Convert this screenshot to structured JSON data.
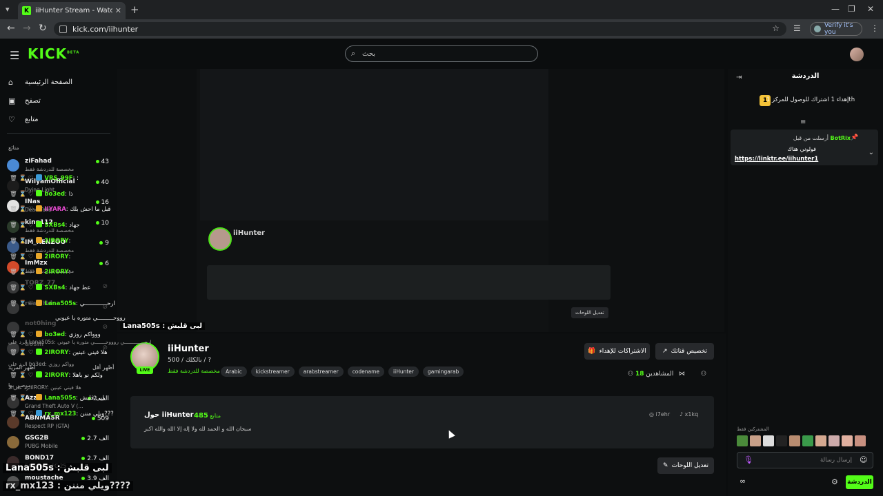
{
  "browser": {
    "tab_title": "iiHunter Stream - Watch Live o",
    "url": "kick.com/iihunter",
    "verify_label": "Verify it's you"
  },
  "topbar": {
    "search_placeholder": "بحث"
  },
  "sidebar": {
    "nav": [
      {
        "label": "الصفحة الرئيسية",
        "icon": "home-icon"
      },
      {
        "label": "تصفح",
        "icon": "browse-icon"
      },
      {
        "label": "متابع",
        "icon": "heart-icon"
      }
    ],
    "following_header": "متابَع",
    "following": [
      {
        "name": "ziFahad",
        "sub": "مخصصة للدردشة فقط",
        "viewers": "43",
        "live": true,
        "color": "#4a8ad6"
      },
      {
        "name": "WilyamOfficial",
        "sub": "Dying Light",
        "viewers": "40",
        "live": true,
        "color": "#1c1c1c"
      },
      {
        "name": "INas",
        "sub": "Dead Take",
        "viewers": "16",
        "live": true,
        "color": "#e2e2e2"
      },
      {
        "name": "king112",
        "sub": "مخصصة للدردشة فقط",
        "viewers": "10",
        "live": true,
        "color": "#2a3a2a"
      },
      {
        "name": "IM_RENZOO",
        "sub": "مخصصة للدردشة فقط",
        "viewers": "9",
        "live": true,
        "color": "#3a5a8a"
      },
      {
        "name": "ImMzx",
        "sub": "مخصصة للدردشة فقط",
        "viewers": "6",
        "live": true,
        "color": "#d24a2a"
      },
      {
        "name": "TORZ_77",
        "sub": "",
        "viewers": "",
        "live": false,
        "color": "#888"
      },
      {
        "name": "realFHd",
        "sub": "",
        "viewers": "",
        "live": false,
        "color": "#888"
      },
      {
        "name": "not0hing",
        "sub": "",
        "viewers": "",
        "live": false,
        "color": "#888"
      },
      {
        "name": "a8sm",
        "sub": "",
        "viewers": "",
        "live": false,
        "color": "#888"
      }
    ],
    "show_more": "أظهر المزيد",
    "show_less": "أظهر أقل",
    "recommended_header": "موصى بها",
    "recommended": [
      {
        "name": "Azzz",
        "sub": "Grand Theft Auto V (...",
        "viewers": "2 الف",
        "color": "#333"
      },
      {
        "name": "ABNMASR",
        "sub": "Respect RP (GTA)",
        "viewers": "509",
        "color": "#5a3a2a"
      },
      {
        "name": "GSG2B",
        "sub": "PUBG Mobile",
        "viewers": "2.7 الف",
        "color": "#8a6a3a"
      },
      {
        "name": "BOND17",
        "sub": "EA Sports FC 25",
        "viewers": "2.7 الف",
        "color": "#3a2a2a"
      },
      {
        "name": "moustache",
        "sub": "",
        "viewers": "3.9 الف",
        "color": "#555"
      }
    ]
  },
  "channel": {
    "name": "iiHunter",
    "subtitle": "بالكلك / 500 / ?",
    "category": "مخصصة للدردشة فقط",
    "live_badge": "LIVE",
    "tags": [
      "Arabic",
      "kickstreamer",
      "arabstreamer",
      "codename",
      "iiHunter",
      "gamingarab"
    ],
    "subs_button": "الاشتراكات للإهداء",
    "customize_button": "تخصيص قناتك",
    "viewers_label": "المشاهدين",
    "viewers_count": "18",
    "about_title": "حول iiHunter",
    "followers_count": "485",
    "followers_label": "متابع",
    "about_text": "سبحان الله و الحمد لله ولا إله إلا الله والله اكبر",
    "social_1": "i7ehr",
    "social_2": "x1kq",
    "edit_panels_button": "تعديل اللوحات"
  },
  "chat": {
    "title": "الدردشة",
    "goal_text": "إهداء 1 اشتراك للوصول للمركز 1th",
    "pinned_sent_by": "أرسلت من قبل",
    "pinned_user": "BotRix",
    "pinned_text": "فولوني هناك",
    "pinned_link": "https://linktr.ee/iihunter1",
    "messages": [
      {
        "user": "VRS_99F",
        "text": ":",
        "color": "#53fc18",
        "badge": "#3a9ad6"
      },
      {
        "user": "bo3ed",
        "text": "ذا",
        "color": "#53fc18",
        "badge": "#53fc18"
      },
      {
        "user": "IIYARA",
        "text": "قبل ما احش بلك",
        "color": "#e64ad0",
        "badge": "#e8a72a"
      },
      {
        "user": "SXBs4",
        "text": "جهاد",
        "color": "#53fc18",
        "badge": "#53fc18"
      },
      {
        "user": "2IRORY",
        "text": "",
        "color": "#53fc18",
        "badge": "#e8a72a"
      },
      {
        "user": "2IRORY",
        "text": "",
        "color": "#53fc18",
        "badge": "#e8a72a"
      },
      {
        "user": "2IRORY",
        "text": "",
        "color": "#53fc18",
        "badge": "#e8a72a"
      },
      {
        "user": "SXBs4",
        "text": "عط جهاد",
        "color": "#53fc18",
        "badge": "#53fc18"
      },
      {
        "user": "Lana505s",
        "text": "ارحـــــــــــــي",
        "color": "#53fc18",
        "badge": "#e8a72a"
      },
      {
        "user": "",
        "text": "رووحـــــــــي متوره يا عيوني",
        "color": "#eee",
        "badge": ""
      },
      {
        "user": "bo3ed",
        "text": "ووواكم روزي",
        "color": "#53fc18",
        "badge": "#e8a72a"
      }
    ],
    "reply_1": "الرد على Lana505s: ارحـــــــــــــي روووحـــــــي متوره يا عيوني",
    "msg_reply_1": {
      "user": "2IRORY",
      "text": "هلا فيني عينين"
    },
    "reply_2": "الرد على bo3ed: وواكم روزي",
    "msg_reply_2": {
      "user": "2IRORY",
      "text": "ولكم نو باهلا"
    },
    "reply_3": "الرد على 2IRORY: هلا فيني عينين",
    "msg_reply_3": {
      "user": "Lana505s",
      "text": "لبى قلبش"
    },
    "msg_last": {
      "user": "rx_mx123",
      "text": "ويلي مننن???"
    },
    "subs_only": "المشتركين فقط",
    "input_placeholder": "إرسال رسالة",
    "send_button": "الدردشة"
  },
  "overlays": {
    "line1": "Lana505s : لبى قلبش",
    "line2": "rx_mx123 : ويلي مننن????"
  }
}
